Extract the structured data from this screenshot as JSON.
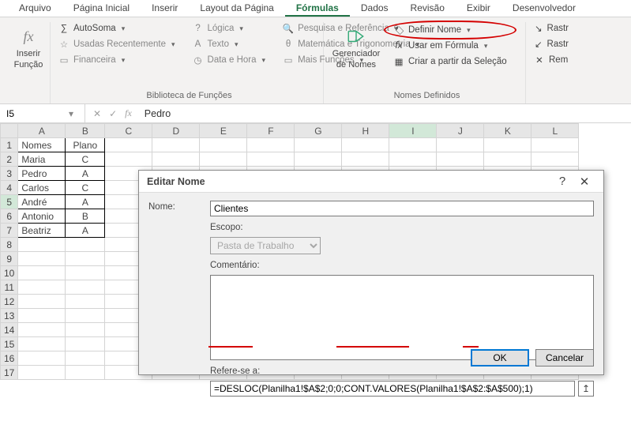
{
  "menubar": {
    "tabs": [
      "Arquivo",
      "Página Inicial",
      "Inserir",
      "Layout da Página",
      "Fórmulas",
      "Dados",
      "Revisão",
      "Exibir",
      "Desenvolvedor"
    ],
    "active_index": 4
  },
  "ribbon": {
    "insert_function": {
      "line1": "Inserir",
      "line2": "Função",
      "fx": "fx"
    },
    "lib": {
      "autosoma": "AutoSoma",
      "recent": "Usadas Recentemente",
      "financeira": "Financeira",
      "logica": "Lógica",
      "texto": "Texto",
      "datahora": "Data e Hora",
      "pesquisa": "Pesquisa e Referência",
      "mattrig": "Matemática e Trigonometria",
      "mais": "Mais Funções",
      "group_label": "Biblioteca de Funções"
    },
    "names": {
      "manager_line1": "Gerenciador",
      "manager_line2": "de Nomes",
      "define": "Definir Nome",
      "use": "Usar em Fórmula",
      "create": "Criar a partir da Seleção",
      "group_label": "Nomes Definidos"
    },
    "audit": {
      "trace_prec": "Rastr",
      "trace_dep": "Rastr",
      "remove": "Rem"
    }
  },
  "formula_bar": {
    "namebox": "I5",
    "value": "Pedro",
    "cancel": "✕",
    "enter": "✓",
    "fx": "fx"
  },
  "sheet": {
    "cols": [
      "A",
      "B",
      "C",
      "D",
      "E",
      "F",
      "G",
      "H",
      "I",
      "J",
      "K",
      "L"
    ],
    "rows": [
      1,
      2,
      3,
      4,
      5,
      6,
      7,
      8,
      9,
      10,
      11,
      12,
      13,
      14,
      15,
      16,
      17
    ],
    "headers": [
      "Nomes",
      "Plano"
    ],
    "data": [
      {
        "nome": "Maria",
        "plano": "C"
      },
      {
        "nome": "Pedro",
        "plano": "A"
      },
      {
        "nome": "Carlos",
        "plano": "C"
      },
      {
        "nome": "André",
        "plano": "A"
      },
      {
        "nome": "Antonio",
        "plano": "B"
      },
      {
        "nome": "Beatriz",
        "plano": "A"
      }
    ],
    "selected_row": 5,
    "selected_col": "I"
  },
  "dialog": {
    "title": "Editar Nome",
    "help": "?",
    "close": "✕",
    "labels": {
      "nome": "Nome:",
      "escopo": "Escopo:",
      "comentario": "Comentário:",
      "ref": "Refere-se a:"
    },
    "name_value": "Clientes",
    "scope_value": "Pasta de Trabalho",
    "comment_value": "",
    "ref_value": "=DESLOC(Planilha1!$A$2;0;0;CONT.VALORES(Planilha1!$A$2:$A$500);1)",
    "ok": "OK",
    "cancel": "Cancelar"
  }
}
